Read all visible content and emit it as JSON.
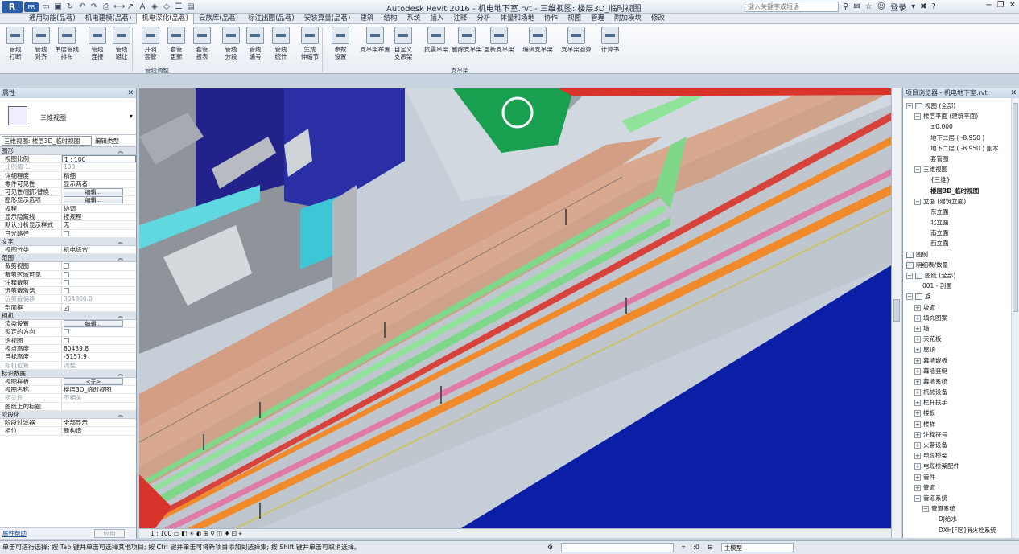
{
  "titlebar": {
    "logo": "R",
    "product_badge": "PR",
    "title": "Autodesk Revit 2016 -    机电地下室.rvt - 三维视图: 楼层3D_临时视图",
    "search_placeholder": "键入关键字或短语",
    "signin": "登录"
  },
  "tabs": [
    "通用功能(品茗)",
    "机电建模(品茗)",
    "机电深化(品茗)",
    "云族库(品茗)",
    "标注出图(品茗)",
    "安装算量(品茗)",
    "建筑",
    "结构",
    "系统",
    "插入",
    "注释",
    "分析",
    "体量和场地",
    "协作",
    "视图",
    "管理",
    "附加模块",
    "修改"
  ],
  "active_tab": "机电深化(品茗)",
  "ribbon": {
    "buttons": [
      {
        "label1": "管线",
        "label2": "打断"
      },
      {
        "label1": "管线",
        "label2": "对齐"
      },
      {
        "label1": "单层管线",
        "label2": "排布"
      },
      {
        "label1": "管线",
        "label2": "连接"
      },
      {
        "label1": "管线",
        "label2": "避让"
      },
      {
        "label1": "开洞",
        "label2": "套管"
      },
      {
        "label1": "套管",
        "label2": "更新"
      },
      {
        "label1": "套管",
        "label2": "报表"
      },
      {
        "label1": "管线",
        "label2": "分段"
      },
      {
        "label1": "管线",
        "label2": "编号"
      },
      {
        "label1": "管线",
        "label2": "统计"
      },
      {
        "label1": "生成",
        "label2": "伸缩节"
      },
      {
        "label1": "参数",
        "label2": "设置"
      },
      {
        "label1": "支吊架布置",
        "label2": ""
      },
      {
        "label1": "自定义",
        "label2": "支吊架"
      },
      {
        "label1": "抗震吊架",
        "label2": ""
      },
      {
        "label1": "删除支吊架",
        "label2": ""
      },
      {
        "label1": "更新支吊架",
        "label2": ""
      },
      {
        "label1": "编辑支吊架",
        "label2": ""
      },
      {
        "label1": "支吊架验算",
        "label2": ""
      },
      {
        "label1": "计算书",
        "label2": ""
      }
    ],
    "panels": [
      "管线调整",
      "支吊架"
    ]
  },
  "properties": {
    "header": "属性",
    "type_name": "三维视图",
    "view_combo": "三维视图: 楼层3D_临时视图",
    "edit_type": "编辑类型",
    "sections": [
      {
        "title": "图形",
        "rows": [
          {
            "k": "视图比例",
            "v": "1 : 100",
            "kind": "input"
          },
          {
            "k": "比例值 1:",
            "v": "100",
            "kind": "grey"
          },
          {
            "k": "详细程度",
            "v": "精细",
            "kind": "text"
          },
          {
            "k": "零件可见性",
            "v": "显示两者",
            "kind": "text"
          },
          {
            "k": "可见性/图形替换",
            "v": "编辑...",
            "kind": "button"
          },
          {
            "k": "图形显示选项",
            "v": "编辑...",
            "kind": "button"
          },
          {
            "k": "规程",
            "v": "协调",
            "kind": "text"
          },
          {
            "k": "显示隐藏线",
            "v": "按规程",
            "kind": "text"
          },
          {
            "k": "默认分析显示样式",
            "v": "无",
            "kind": "text"
          },
          {
            "k": "日光路径",
            "v": "",
            "kind": "checkbox"
          }
        ]
      },
      {
        "title": "文字",
        "rows": [
          {
            "k": "视图分类",
            "v": "机电综合",
            "kind": "text"
          }
        ]
      },
      {
        "title": "范围",
        "rows": [
          {
            "k": "裁剪视图",
            "v": "",
            "kind": "checkbox"
          },
          {
            "k": "裁剪区域可见",
            "v": "",
            "kind": "checkbox"
          },
          {
            "k": "注释裁剪",
            "v": "",
            "kind": "checkbox"
          },
          {
            "k": "远剪裁激活",
            "v": "",
            "kind": "checkbox"
          },
          {
            "k": "远剪裁偏移",
            "v": "304800.0",
            "kind": "grey"
          },
          {
            "k": "剖面框",
            "v": "✓",
            "kind": "checkbox"
          }
        ]
      },
      {
        "title": "相机",
        "rows": [
          {
            "k": "渲染设置",
            "v": "编辑...",
            "kind": "button"
          },
          {
            "k": "锁定的方向",
            "v": "",
            "kind": "checkbox-grey"
          },
          {
            "k": "透视图",
            "v": "",
            "kind": "checkbox-grey"
          },
          {
            "k": "视点高度",
            "v": "80439.8",
            "kind": "text"
          },
          {
            "k": "目标高度",
            "v": "-5157.9",
            "kind": "text"
          },
          {
            "k": "相机位置",
            "v": "调整",
            "kind": "grey"
          }
        ]
      },
      {
        "title": "标识数据",
        "rows": [
          {
            "k": "视图样板",
            "v": "<无>",
            "kind": "button"
          },
          {
            "k": "视图名称",
            "v": "楼层3D_临时视图",
            "kind": "text"
          },
          {
            "k": "相关性",
            "v": "不相关",
            "kind": "grey"
          },
          {
            "k": "图纸上的标题",
            "v": "",
            "kind": "text"
          }
        ]
      },
      {
        "title": "阶段化",
        "rows": [
          {
            "k": "阶段过滤器",
            "v": "全部显示",
            "kind": "text"
          },
          {
            "k": "相位",
            "v": "新构造",
            "kind": "text"
          }
        ]
      }
    ],
    "help_link": "属性帮助",
    "apply": "应用"
  },
  "view_bar": {
    "scale": "1 : 100"
  },
  "browser": {
    "header": "项目浏览器 - 机电地下室.rvt",
    "nodes": [
      {
        "t": "视图 (全部)",
        "d": 0,
        "tg": "−",
        "icon": true
      },
      {
        "t": "楼层平面 (建筑平面)",
        "d": 1,
        "tg": "−"
      },
      {
        "t": "±0.000",
        "d": 3
      },
      {
        "t": "地下二层 ( -8.950 )",
        "d": 3
      },
      {
        "t": "地下二层 ( -8.950 ) 副本",
        "d": 3
      },
      {
        "t": "套管图",
        "d": 3
      },
      {
        "t": "三维视图",
        "d": 1,
        "tg": "−"
      },
      {
        "t": "{三维}",
        "d": 3
      },
      {
        "t": "楼层3D_临时视图",
        "d": 3,
        "bold": true
      },
      {
        "t": "立面 (建筑立面)",
        "d": 1,
        "tg": "−"
      },
      {
        "t": "东立面",
        "d": 3
      },
      {
        "t": "北立面",
        "d": 3
      },
      {
        "t": "南立面",
        "d": 3
      },
      {
        "t": "西立面",
        "d": 3
      },
      {
        "t": "图例",
        "d": 0,
        "icon": true
      },
      {
        "t": "明细表/数量",
        "d": 0,
        "icon": true
      },
      {
        "t": "图纸 (全部)",
        "d": 0,
        "tg": "−",
        "icon": true
      },
      {
        "t": "001 - 剖面",
        "d": 2
      },
      {
        "t": "族",
        "d": 0,
        "tg": "−",
        "icon": true
      },
      {
        "t": "坡道",
        "d": 1,
        "tg": "+"
      },
      {
        "t": "填充图案",
        "d": 1,
        "tg": "+"
      },
      {
        "t": "墙",
        "d": 1,
        "tg": "+"
      },
      {
        "t": "天花板",
        "d": 1,
        "tg": "+"
      },
      {
        "t": "屋顶",
        "d": 1,
        "tg": "+"
      },
      {
        "t": "幕墙嵌板",
        "d": 1,
        "tg": "+"
      },
      {
        "t": "幕墙竖梃",
        "d": 1,
        "tg": "+"
      },
      {
        "t": "幕墙系统",
        "d": 1,
        "tg": "+"
      },
      {
        "t": "机械设备",
        "d": 1,
        "tg": "+"
      },
      {
        "t": "栏杆扶手",
        "d": 1,
        "tg": "+"
      },
      {
        "t": "楼板",
        "d": 1,
        "tg": "+"
      },
      {
        "t": "楼梯",
        "d": 1,
        "tg": "+"
      },
      {
        "t": "注释符号",
        "d": 1,
        "tg": "+"
      },
      {
        "t": "火警设备",
        "d": 1,
        "tg": "+"
      },
      {
        "t": "电缆桥架",
        "d": 1,
        "tg": "+"
      },
      {
        "t": "电缆桥架配件",
        "d": 1,
        "tg": "+"
      },
      {
        "t": "管件",
        "d": 1,
        "tg": "+"
      },
      {
        "t": "管道",
        "d": 1,
        "tg": "+"
      },
      {
        "t": "管道系统",
        "d": 1,
        "tg": "−"
      },
      {
        "t": "管道系统",
        "d": 2,
        "tg": "−"
      },
      {
        "t": "DJ给水",
        "d": 4
      },
      {
        "t": "DXH[F区]消火栓系统",
        "d": 4
      }
    ]
  },
  "status": {
    "text": "单击可进行选择; 按 Tab 键并单击可选择其他项目; 按 Ctrl 键并单击可将新项目添加到选择集; 按 Shift 键并单击可取消选择。",
    "sel_count": ":0",
    "model": "主模型"
  },
  "colors": {
    "pipe_green": "#7fd88a",
    "pipe_orange": "#f08a2a",
    "pipe_pink": "#e07ba8",
    "pipe_red": "#d9342b",
    "slab_tan": "#d6a188",
    "floor_blue": "#0a1fa6"
  }
}
